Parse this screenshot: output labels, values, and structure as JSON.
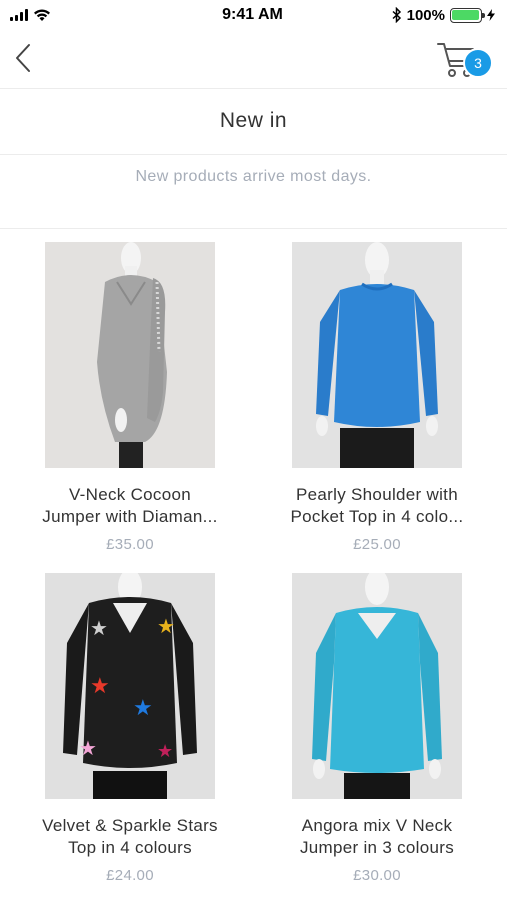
{
  "status_bar": {
    "time": "9:41 AM",
    "battery_text": "100%"
  },
  "nav": {
    "cart_count": "3"
  },
  "header": {
    "title": "New in",
    "subtitle": "New products arrive most days."
  },
  "products": [
    {
      "name_line1": "V-Neck Cocoon",
      "name_line2": "Jumper with Diaman...",
      "price": "£35.00",
      "color": "#9e9e9e"
    },
    {
      "name_line1": "Pearly Shoulder with",
      "name_line2": "Pocket Top in 4 colo...",
      "price": "£25.00",
      "color": "#2f86d6"
    },
    {
      "name_line1": "Velvet & Sparkle Stars",
      "name_line2": "Top in 4 colours",
      "price": "£24.00",
      "color": "#1e1e1e"
    },
    {
      "name_line1": "Angora mix V Neck",
      "name_line2": "Jumper in 3 colours",
      "price": "£30.00",
      "color": "#36b6d8"
    }
  ],
  "colors": {
    "accent": "#1a9be6",
    "muted_text": "#a6adb8",
    "battery": "#4cd964"
  }
}
